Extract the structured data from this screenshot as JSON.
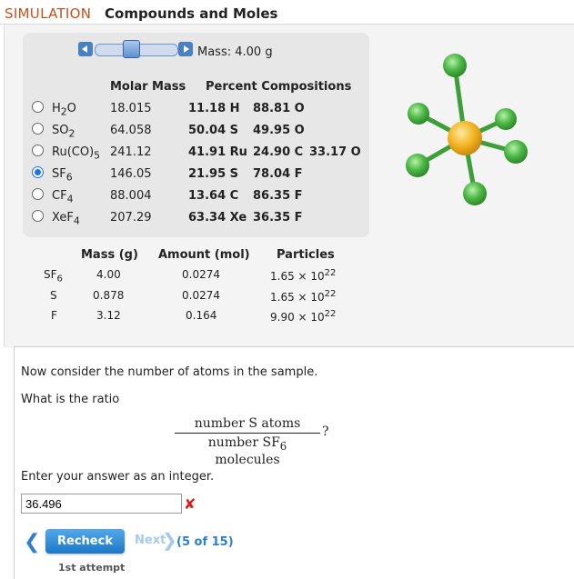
{
  "header": {
    "sim": "SIMULATION",
    "title": "Compounds and Moles"
  },
  "slider": {
    "mass_label": "Mass: 4.00 g"
  },
  "compounds_table": {
    "headers": {
      "molar_mass": "Molar Mass",
      "percent": "Percent Compositions"
    },
    "rows": [
      {
        "formula": "H",
        "sub": "2",
        "rest": "O",
        "rest_sub": "",
        "molar": "18.015",
        "c1": "11.18 H",
        "c2": "88.81 O",
        "c3": "",
        "selected": false
      },
      {
        "formula": "SO",
        "sub": "2",
        "rest": "",
        "rest_sub": "",
        "molar": "64.058",
        "c1": "50.04 S",
        "c2": "49.95 O",
        "c3": "",
        "selected": false
      },
      {
        "formula": "Ru(CO)",
        "sub": "5",
        "rest": "",
        "rest_sub": "",
        "molar": "241.12",
        "c1": "41.91 Ru",
        "c2": "24.90 C",
        "c3": "33.17 O",
        "selected": false
      },
      {
        "formula": "SF",
        "sub": "6",
        "rest": "",
        "rest_sub": "",
        "molar": "146.05",
        "c1": "21.95 S",
        "c2": "78.04 F",
        "c3": "",
        "selected": true
      },
      {
        "formula": "CF",
        "sub": "4",
        "rest": "",
        "rest_sub": "",
        "molar": "88.004",
        "c1": "13.64 C",
        "c2": "86.35 F",
        "c3": "",
        "selected": false
      },
      {
        "formula": "XeF",
        "sub": "4",
        "rest": "",
        "rest_sub": "",
        "molar": "207.29",
        "c1": "63.34 Xe",
        "c2": "36.35 F",
        "c3": "",
        "selected": false
      }
    ]
  },
  "amounts_table": {
    "headers": {
      "mass": "Mass (g)",
      "amount": "Amount (mol)",
      "particles": "Particles"
    },
    "rows": [
      {
        "label": "SF",
        "label_sub": "6",
        "mass": "4.00",
        "amount": "0.0274",
        "particles": "1.65 × 10",
        "exp": "22"
      },
      {
        "label": "S",
        "label_sub": "",
        "mass": "0.878",
        "amount": "0.0274",
        "particles": "1.65 × 10",
        "exp": "22"
      },
      {
        "label": "F",
        "label_sub": "",
        "mass": "3.12",
        "amount": "0.164",
        "particles": "9.90 × 10",
        "exp": "22"
      }
    ]
  },
  "question": {
    "line1": "Now consider the number of atoms in the sample.",
    "line2": "What is the ratio",
    "numerator": "number S atoms",
    "denominator_pre": "number SF",
    "denominator_sub": "6",
    "denominator_post": " molecules",
    "qmark": "?",
    "instruction": "Enter your answer as an integer.",
    "answer_value": "36.496"
  },
  "controls": {
    "recheck": "Recheck",
    "next": "Next",
    "progress": "(5 of 15)",
    "attempt": "1st attempt"
  },
  "colors": {
    "sim": "#c8501e",
    "accent": "#1c78c8",
    "error": "#d4201c",
    "sulfur": "#f2b21e",
    "fluorine": "#4cb847"
  }
}
